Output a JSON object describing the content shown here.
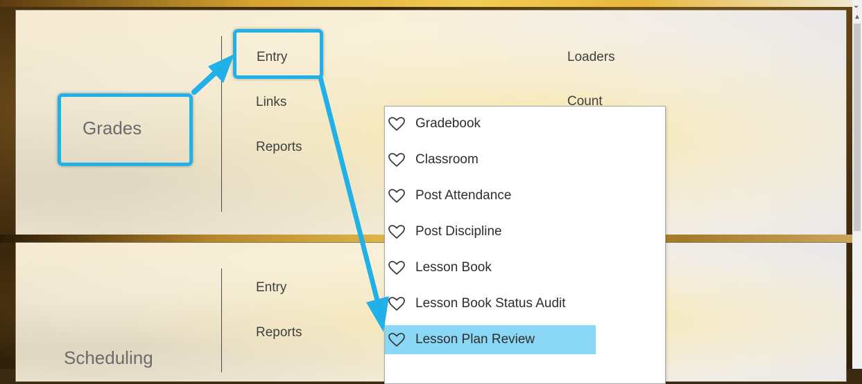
{
  "grades": {
    "title": "Grades",
    "col1": [
      "Entry",
      "Links",
      "Reports"
    ],
    "col2": [
      "Loaders",
      "Count"
    ]
  },
  "scheduling": {
    "title": "Scheduling",
    "col1": [
      "Entry",
      "Reports"
    ]
  },
  "dropdown": {
    "items": [
      {
        "label": "Gradebook",
        "icon": "heart-outline-icon"
      },
      {
        "label": "Classroom",
        "icon": "heart-outline-icon"
      },
      {
        "label": "Post Attendance",
        "icon": "heart-outline-icon"
      },
      {
        "label": "Post Discipline",
        "icon": "heart-outline-icon"
      },
      {
        "label": "Lesson Book",
        "icon": "heart-outline-icon"
      },
      {
        "label": "Lesson Book Status Audit",
        "icon": "heart-outline-icon"
      },
      {
        "label": "Lesson Plan Review",
        "icon": "heart-outline-icon",
        "selected": true
      }
    ]
  },
  "colors": {
    "callout": "#21b0e8",
    "selected_row": "#8ad8f5"
  }
}
